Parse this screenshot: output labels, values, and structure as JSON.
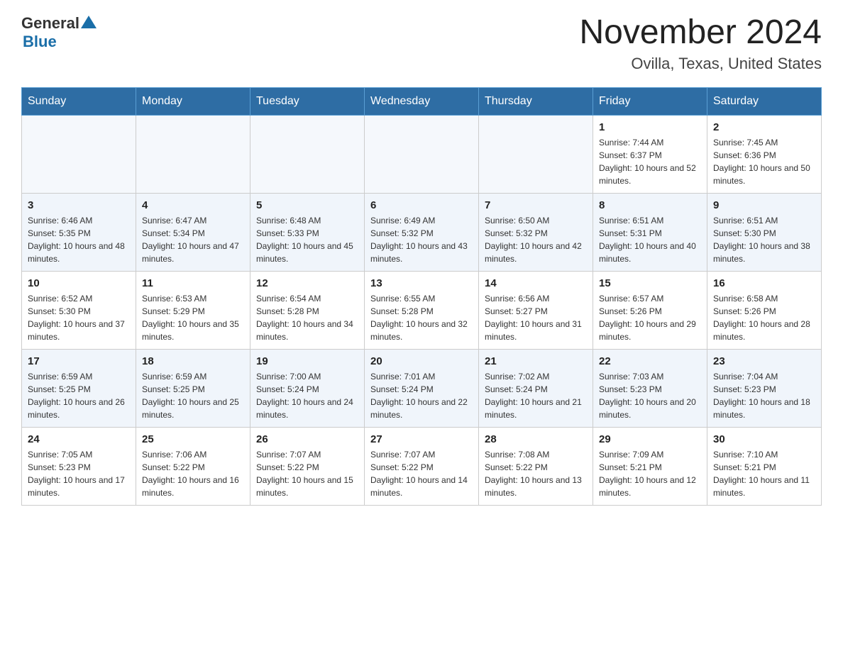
{
  "header": {
    "logo_general": "General",
    "logo_blue": "Blue",
    "month_title": "November 2024",
    "location": "Ovilla, Texas, United States"
  },
  "weekdays": [
    "Sunday",
    "Monday",
    "Tuesday",
    "Wednesday",
    "Thursday",
    "Friday",
    "Saturday"
  ],
  "weeks": [
    [
      {
        "day": "",
        "sunrise": "",
        "sunset": "",
        "daylight": ""
      },
      {
        "day": "",
        "sunrise": "",
        "sunset": "",
        "daylight": ""
      },
      {
        "day": "",
        "sunrise": "",
        "sunset": "",
        "daylight": ""
      },
      {
        "day": "",
        "sunrise": "",
        "sunset": "",
        "daylight": ""
      },
      {
        "day": "",
        "sunrise": "",
        "sunset": "",
        "daylight": ""
      },
      {
        "day": "1",
        "sunrise": "Sunrise: 7:44 AM",
        "sunset": "Sunset: 6:37 PM",
        "daylight": "Daylight: 10 hours and 52 minutes."
      },
      {
        "day": "2",
        "sunrise": "Sunrise: 7:45 AM",
        "sunset": "Sunset: 6:36 PM",
        "daylight": "Daylight: 10 hours and 50 minutes."
      }
    ],
    [
      {
        "day": "3",
        "sunrise": "Sunrise: 6:46 AM",
        "sunset": "Sunset: 5:35 PM",
        "daylight": "Daylight: 10 hours and 48 minutes."
      },
      {
        "day": "4",
        "sunrise": "Sunrise: 6:47 AM",
        "sunset": "Sunset: 5:34 PM",
        "daylight": "Daylight: 10 hours and 47 minutes."
      },
      {
        "day": "5",
        "sunrise": "Sunrise: 6:48 AM",
        "sunset": "Sunset: 5:33 PM",
        "daylight": "Daylight: 10 hours and 45 minutes."
      },
      {
        "day": "6",
        "sunrise": "Sunrise: 6:49 AM",
        "sunset": "Sunset: 5:32 PM",
        "daylight": "Daylight: 10 hours and 43 minutes."
      },
      {
        "day": "7",
        "sunrise": "Sunrise: 6:50 AM",
        "sunset": "Sunset: 5:32 PM",
        "daylight": "Daylight: 10 hours and 42 minutes."
      },
      {
        "day": "8",
        "sunrise": "Sunrise: 6:51 AM",
        "sunset": "Sunset: 5:31 PM",
        "daylight": "Daylight: 10 hours and 40 minutes."
      },
      {
        "day": "9",
        "sunrise": "Sunrise: 6:51 AM",
        "sunset": "Sunset: 5:30 PM",
        "daylight": "Daylight: 10 hours and 38 minutes."
      }
    ],
    [
      {
        "day": "10",
        "sunrise": "Sunrise: 6:52 AM",
        "sunset": "Sunset: 5:30 PM",
        "daylight": "Daylight: 10 hours and 37 minutes."
      },
      {
        "day": "11",
        "sunrise": "Sunrise: 6:53 AM",
        "sunset": "Sunset: 5:29 PM",
        "daylight": "Daylight: 10 hours and 35 minutes."
      },
      {
        "day": "12",
        "sunrise": "Sunrise: 6:54 AM",
        "sunset": "Sunset: 5:28 PM",
        "daylight": "Daylight: 10 hours and 34 minutes."
      },
      {
        "day": "13",
        "sunrise": "Sunrise: 6:55 AM",
        "sunset": "Sunset: 5:28 PM",
        "daylight": "Daylight: 10 hours and 32 minutes."
      },
      {
        "day": "14",
        "sunrise": "Sunrise: 6:56 AM",
        "sunset": "Sunset: 5:27 PM",
        "daylight": "Daylight: 10 hours and 31 minutes."
      },
      {
        "day": "15",
        "sunrise": "Sunrise: 6:57 AM",
        "sunset": "Sunset: 5:26 PM",
        "daylight": "Daylight: 10 hours and 29 minutes."
      },
      {
        "day": "16",
        "sunrise": "Sunrise: 6:58 AM",
        "sunset": "Sunset: 5:26 PM",
        "daylight": "Daylight: 10 hours and 28 minutes."
      }
    ],
    [
      {
        "day": "17",
        "sunrise": "Sunrise: 6:59 AM",
        "sunset": "Sunset: 5:25 PM",
        "daylight": "Daylight: 10 hours and 26 minutes."
      },
      {
        "day": "18",
        "sunrise": "Sunrise: 6:59 AM",
        "sunset": "Sunset: 5:25 PM",
        "daylight": "Daylight: 10 hours and 25 minutes."
      },
      {
        "day": "19",
        "sunrise": "Sunrise: 7:00 AM",
        "sunset": "Sunset: 5:24 PM",
        "daylight": "Daylight: 10 hours and 24 minutes."
      },
      {
        "day": "20",
        "sunrise": "Sunrise: 7:01 AM",
        "sunset": "Sunset: 5:24 PM",
        "daylight": "Daylight: 10 hours and 22 minutes."
      },
      {
        "day": "21",
        "sunrise": "Sunrise: 7:02 AM",
        "sunset": "Sunset: 5:24 PM",
        "daylight": "Daylight: 10 hours and 21 minutes."
      },
      {
        "day": "22",
        "sunrise": "Sunrise: 7:03 AM",
        "sunset": "Sunset: 5:23 PM",
        "daylight": "Daylight: 10 hours and 20 minutes."
      },
      {
        "day": "23",
        "sunrise": "Sunrise: 7:04 AM",
        "sunset": "Sunset: 5:23 PM",
        "daylight": "Daylight: 10 hours and 18 minutes."
      }
    ],
    [
      {
        "day": "24",
        "sunrise": "Sunrise: 7:05 AM",
        "sunset": "Sunset: 5:23 PM",
        "daylight": "Daylight: 10 hours and 17 minutes."
      },
      {
        "day": "25",
        "sunrise": "Sunrise: 7:06 AM",
        "sunset": "Sunset: 5:22 PM",
        "daylight": "Daylight: 10 hours and 16 minutes."
      },
      {
        "day": "26",
        "sunrise": "Sunrise: 7:07 AM",
        "sunset": "Sunset: 5:22 PM",
        "daylight": "Daylight: 10 hours and 15 minutes."
      },
      {
        "day": "27",
        "sunrise": "Sunrise: 7:07 AM",
        "sunset": "Sunset: 5:22 PM",
        "daylight": "Daylight: 10 hours and 14 minutes."
      },
      {
        "day": "28",
        "sunrise": "Sunrise: 7:08 AM",
        "sunset": "Sunset: 5:22 PM",
        "daylight": "Daylight: 10 hours and 13 minutes."
      },
      {
        "day": "29",
        "sunrise": "Sunrise: 7:09 AM",
        "sunset": "Sunset: 5:21 PM",
        "daylight": "Daylight: 10 hours and 12 minutes."
      },
      {
        "day": "30",
        "sunrise": "Sunrise: 7:10 AM",
        "sunset": "Sunset: 5:21 PM",
        "daylight": "Daylight: 10 hours and 11 minutes."
      }
    ]
  ]
}
